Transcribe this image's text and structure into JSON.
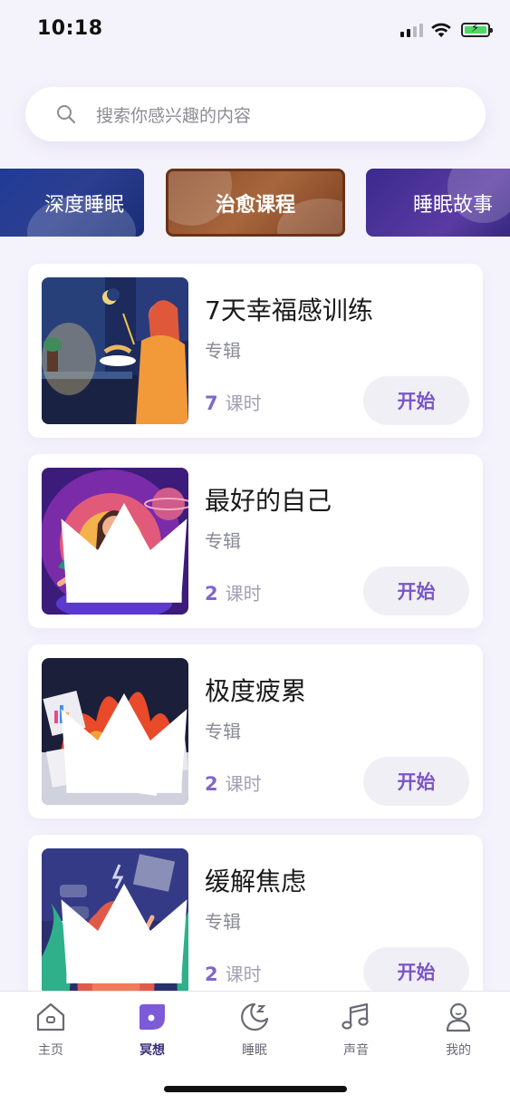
{
  "status_bar": {
    "time": "10:18"
  },
  "search": {
    "placeholder": "搜索你感兴趣的内容"
  },
  "categories": [
    {
      "label": "深度睡眠"
    },
    {
      "label": "治愈课程"
    },
    {
      "label": "睡眠故事"
    }
  ],
  "courses": [
    {
      "title": "7天幸福感训练",
      "type": "专辑",
      "lesson_count": "7",
      "lesson_unit": "课时",
      "button": "开始",
      "premium": false
    },
    {
      "title": "最好的自己",
      "type": "专辑",
      "lesson_count": "2",
      "lesson_unit": "课时",
      "button": "开始",
      "premium": true
    },
    {
      "title": "极度疲累",
      "type": "专辑",
      "lesson_count": "2",
      "lesson_unit": "课时",
      "button": "开始",
      "premium": true
    },
    {
      "title": "缓解焦虑",
      "type": "专辑",
      "lesson_count": "2",
      "lesson_unit": "课时",
      "button": "开始",
      "premium": true
    }
  ],
  "tab_bar": {
    "tabs": [
      {
        "label": "主页",
        "icon": "home-icon",
        "active": false
      },
      {
        "label": "冥想",
        "icon": "meditation-icon",
        "active": true
      },
      {
        "label": "睡眠",
        "icon": "moon-icon",
        "active": false
      },
      {
        "label": "声音",
        "icon": "music-note-icon",
        "active": false
      },
      {
        "label": "我的",
        "icon": "profile-icon",
        "active": false
      }
    ]
  },
  "colors": {
    "accent": "#7a55c7",
    "background": "#f4f2fb",
    "tab_active": "#7c5ad8"
  }
}
